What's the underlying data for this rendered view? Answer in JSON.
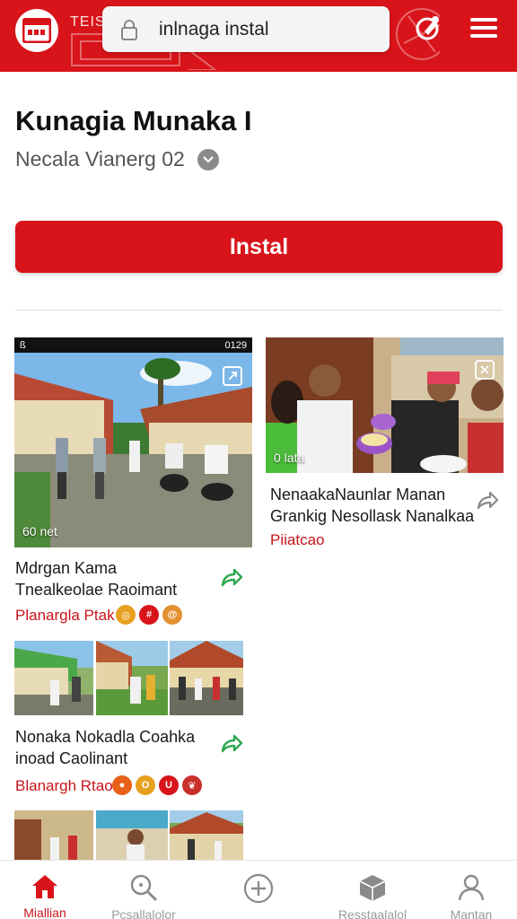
{
  "header": {
    "brand": "TEIS",
    "url": "inlnaga instal"
  },
  "app": {
    "title": "Kunagia Munaka I",
    "developer": "Necala Vianerg 02",
    "install_label": "Instal"
  },
  "cards": [
    {
      "status_left": "ß",
      "status_time": "0129",
      "overlay": "60 net",
      "title_line1": "Mdrgan Kama",
      "title_line2": "Tnealkeolae Raoimant",
      "tag": "Planargla Ptak"
    },
    {
      "overlay": "0 lata",
      "title_line1": "NenaakaNaunlar Manan",
      "title_line2": "Grankig Nesollask Nanalkaa",
      "tag": "Piiatcao"
    },
    {
      "title_line1": "Nonaka Nokadla Coahka",
      "title_line2": "inoad Caolinant",
      "tag": "Blanargh Rtao"
    }
  ],
  "nav": [
    {
      "label": "Miallian",
      "icon": "home-icon"
    },
    {
      "label": "Pcsallalolor",
      "icon": "search-icon"
    },
    {
      "label": "",
      "icon": "add-circle-icon"
    },
    {
      "label": "Resstaalalol",
      "icon": "package-icon"
    },
    {
      "label": "Mantan",
      "icon": "profile-icon"
    }
  ],
  "colors": {
    "accent": "#d8141a",
    "tag": "#c8141a",
    "share_icon": "#2fa84f"
  }
}
